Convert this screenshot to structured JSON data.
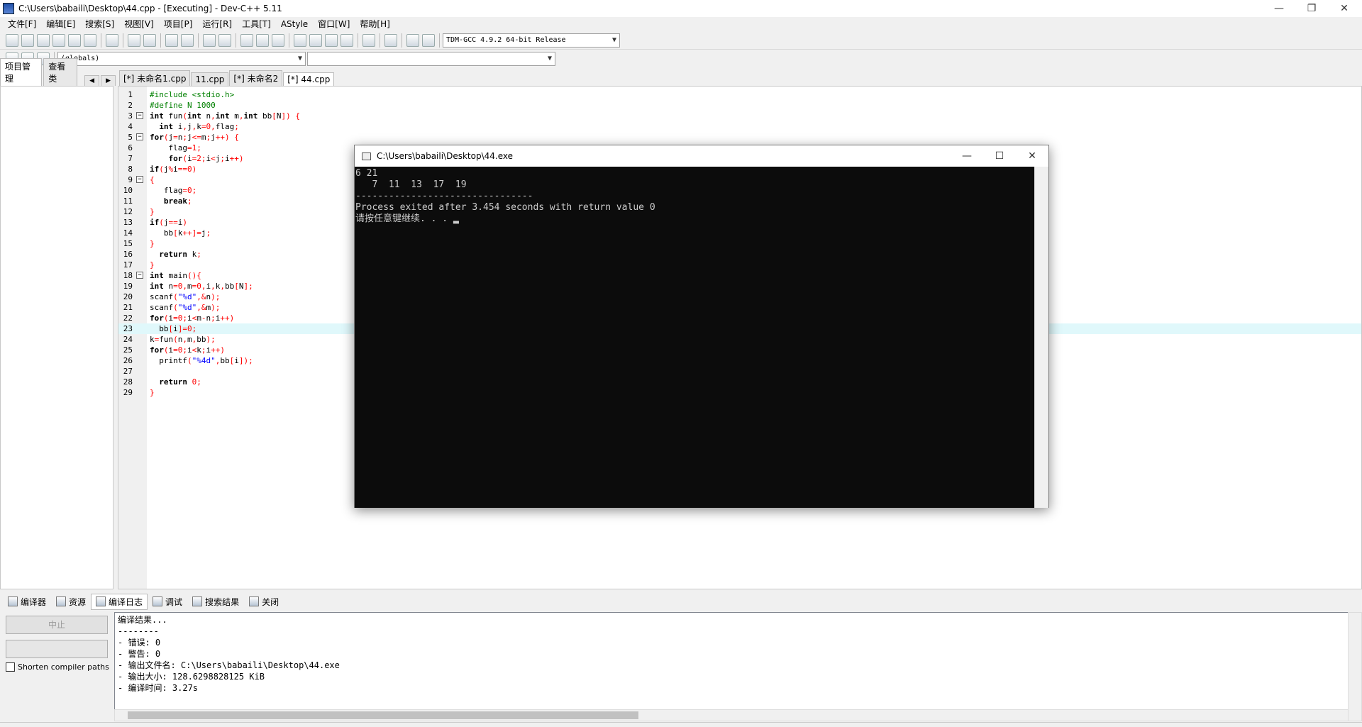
{
  "window": {
    "title": "C:\\Users\\babaili\\Desktop\\44.cpp - [Executing] - Dev-C++ 5.11",
    "minimize": "—",
    "restore": "❐",
    "close": "✕"
  },
  "menu": [
    "文件[F]",
    "编辑[E]",
    "搜索[S]",
    "视图[V]",
    "项目[P]",
    "运行[R]",
    "工具[T]",
    "AStyle",
    "窗口[W]",
    "帮助[H]"
  ],
  "toolbar": {
    "compiler_select": "TDM-GCC 4.9.2 64-bit Release",
    "scope_select": "(globals)",
    "symbol_select": ""
  },
  "left_panel": {
    "tabs": [
      "项目管理",
      "查看类"
    ],
    "nav_prev": "◀",
    "nav_next": "▶"
  },
  "editor_tabs": [
    "[*] 未命名1.cpp",
    "11.cpp",
    "[*] 未命名2",
    "[*] 44.cpp"
  ],
  "code_lines": [
    "#include <stdio.h>",
    "#define N 1000",
    "int fun(int n,int m,int bb[N]) {",
    "  int i,j,k=0,flag;",
    "for(j=n;j<=m;j++) {",
    "    flag=1;",
    "    for(i=2;i<j;i++)",
    "if(j%i==0)",
    "{",
    "   flag=0;",
    "   break;",
    "}",
    "if(j==i)",
    "   bb[k++]=j;",
    "}",
    "  return k;",
    "}",
    "int main(){",
    "int n=0,m=0,i,k,bb[N];",
    "scanf(\"%d\",&n);",
    "scanf(\"%d\",&m);",
    "for(i=0;i<m-n;i++)",
    "  bb[i]=0;",
    "k=fun(n,m,bb);",
    "for(i=0;i<k;i++)",
    "  printf(\"%4d\",bb[i]);",
    "",
    "  return 0;",
    "}"
  ],
  "console": {
    "title": "C:\\Users\\babaili\\Desktop\\44.exe",
    "minimize": "—",
    "maximize": "☐",
    "close": "✕",
    "output": "6 21\n   7  11  13  17  19\n--------------------------------\nProcess exited after 3.454 seconds with return value 0\n请按任意键继续. . . ▂"
  },
  "bottom_tabs": [
    "编译器",
    "资源",
    "编译日志",
    "调试",
    "搜索结果",
    "关闭"
  ],
  "bottom_left": {
    "abort_button": "中止",
    "shorten_label": "Shorten compiler paths"
  },
  "compile_log": "编译结果...\n--------\n- 错误: 0\n- 警告: 0\n- 输出文件名: C:\\Users\\babaili\\Desktop\\44.exe\n- 输出大小: 128.6298828125 KiB\n- 编译时间: 3.27s"
}
